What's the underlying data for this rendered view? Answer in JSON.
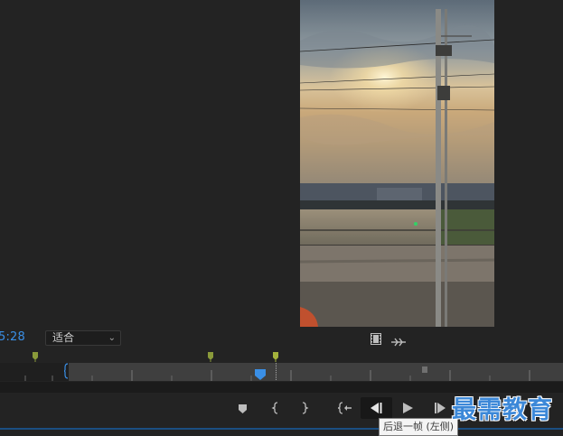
{
  "timecode": "5:28",
  "zoom": {
    "selected": "适合"
  },
  "tooltip": "后退一帧 (左侧)",
  "watermark": "最需教育",
  "colors": {
    "accent": "#3a8fe6",
    "marker": "#8a9a3a",
    "panel_bg": "#232323",
    "track_fill": "#3f3f3f"
  },
  "icons": {
    "frame_export": "film-strip-icon",
    "settings": "settings-wrench-icon",
    "marker": "marker-icon",
    "in": "mark-in-icon",
    "out": "mark-out-icon",
    "go_to_in": "go-to-in-icon",
    "step_back": "step-back-icon",
    "play": "play-icon",
    "step_forward": "step-forward-icon"
  }
}
